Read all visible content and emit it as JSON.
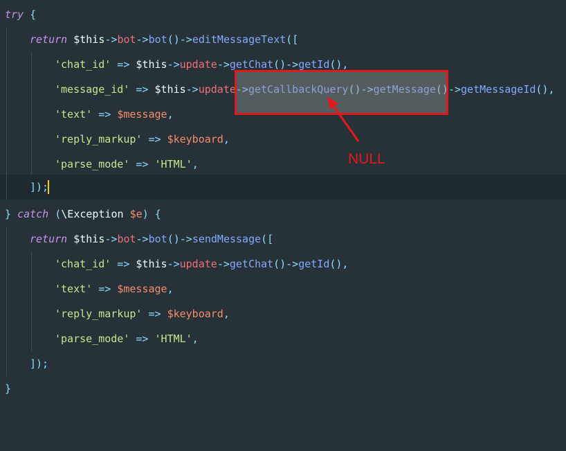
{
  "annotation": {
    "label": "NULL",
    "color": "#e4191b"
  },
  "colors": {
    "background": "#263238",
    "keyword": "#c792ea",
    "property": "#f07178",
    "function": "#82aaff",
    "string": "#c3e88d",
    "variable": "#f78c6c",
    "caret": "#ffcc00"
  },
  "code": {
    "l1": {
      "kw": "try",
      "rest": " {"
    },
    "l2": {
      "kw": "return",
      "this": " $this",
      "arrow1": "->",
      "prop": "bot",
      "arrow2": "->",
      "fn1": "bot",
      "paren1": "()",
      "arrow3": "->",
      "fn2": "editMessageText",
      "tail": "(["
    },
    "l3": {
      "str": "'chat_id'",
      "arrow": " => ",
      "this": "$this",
      "a1": "->",
      "prop": "update",
      "a2": "->",
      "fn1": "getChat",
      "p1": "()",
      "a3": "->",
      "fn2": "getId",
      "tail": "(),"
    },
    "l4": {
      "str": "'message_id'",
      "arrow": " => ",
      "this": "$this",
      "a1": "->",
      "prop": "update",
      "a2": "->",
      "fn1": "getCallbackQuery",
      "p1": "()",
      "a3": "->",
      "fn2": "getMessage",
      "p2": "()",
      "a4": "->",
      "fn3": "getMessageId",
      "tail": "(),"
    },
    "l5": {
      "str": "'text'",
      "arrow": " => ",
      "var": "$message",
      "tail": ","
    },
    "l6": {
      "str": "'reply_markup'",
      "arrow": " => ",
      "var": "$keyboard",
      "tail": ","
    },
    "l7": {
      "str": "'parse_mode'",
      "arrow": " => ",
      "str2": "'HTML'",
      "tail": ","
    },
    "l8": {
      "text": "]);"
    },
    "l9": {
      "open": "} ",
      "kw": "catch",
      "p1": " (",
      "cls": "\\Exception ",
      "var": "$e",
      "tail": ") {"
    },
    "l10": {
      "kw": "return",
      "this": " $this",
      "arrow1": "->",
      "prop": "bot",
      "arrow2": "->",
      "fn1": "bot",
      "paren1": "()",
      "arrow3": "->",
      "fn2": "sendMessage",
      "tail": "(["
    },
    "l11": {
      "str": "'chat_id'",
      "arrow": " => ",
      "this": "$this",
      "a1": "->",
      "prop": "update",
      "a2": "->",
      "fn1": "getChat",
      "p1": "()",
      "a3": "->",
      "fn2": "getId",
      "tail": "(),"
    },
    "l12": {
      "str": "'text'",
      "arrow": " => ",
      "var": "$message",
      "tail": ","
    },
    "l13": {
      "str": "'reply_markup'",
      "arrow": " => ",
      "var": "$keyboard",
      "tail": ","
    },
    "l14": {
      "str": "'parse_mode'",
      "arrow": " => ",
      "str2": "'HTML'",
      "tail": ","
    },
    "l15": {
      "text": "]);"
    },
    "l16": {
      "text": "}"
    }
  }
}
